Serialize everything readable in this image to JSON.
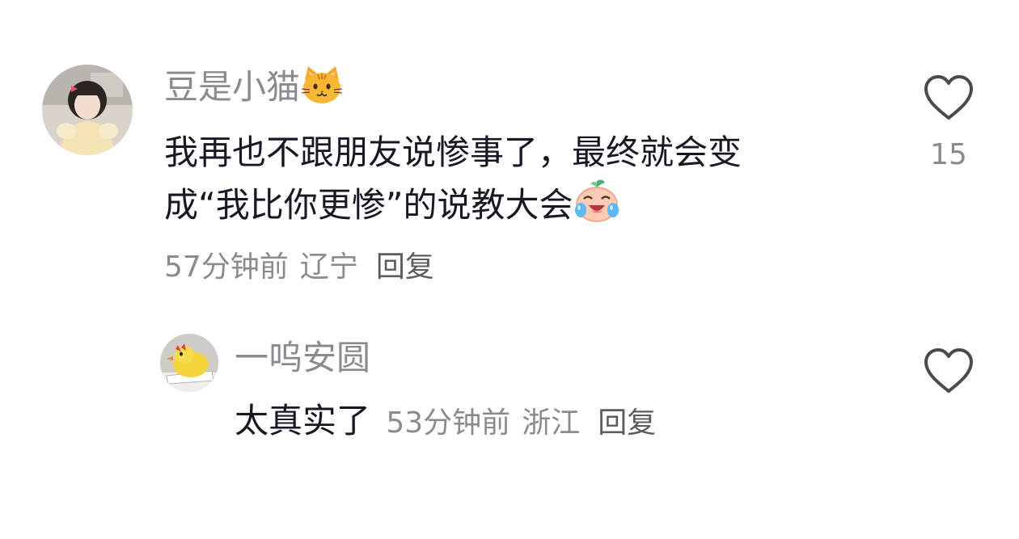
{
  "comments": [
    {
      "username": "豆是小猫",
      "username_emoji": "cat-face-icon",
      "content_lines": [
        "我再也不跟朋友说惨事了，最终就会变",
        "成“我比你更惨”的说教大会"
      ],
      "content_emoji": "crying-laughing-emoji-icon",
      "time": "57分钟前",
      "location": "辽宁",
      "reply_label": "回复",
      "like_count": "15"
    }
  ],
  "replies": [
    {
      "username": "一呜安圆",
      "content": "太真实了",
      "time": "53分钟前",
      "location": "浙江",
      "reply_label": "回复",
      "like_count": ""
    }
  ],
  "colors": {
    "username": "#8a8b91",
    "content": "#161823",
    "meta": "#8a8b91",
    "like_outline": "#4a4b50"
  }
}
